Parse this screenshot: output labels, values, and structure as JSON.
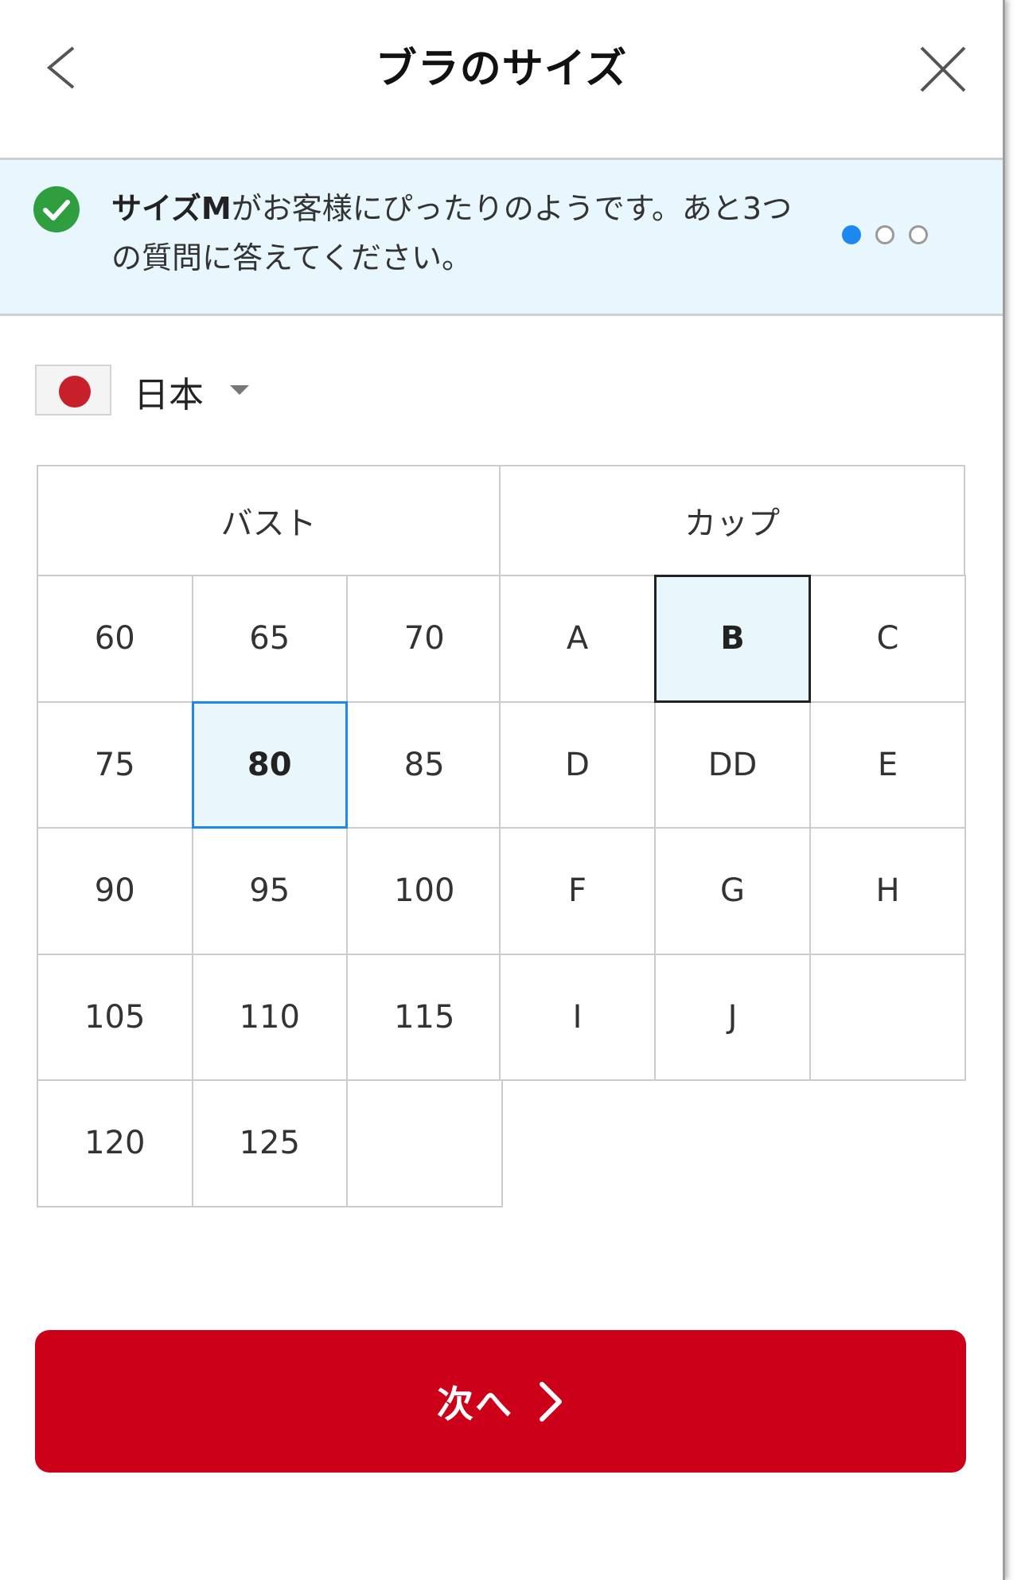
{
  "header": {
    "title": "ブラのサイズ"
  },
  "banner": {
    "bold_text": "サイズM",
    "message": "がお客様にぴったりのようです。あと3つの質問に答えてください。",
    "progress": {
      "current_step": 1,
      "total_steps": 3
    }
  },
  "country": {
    "name": "日本",
    "flag": "japan-flag"
  },
  "bust": {
    "header": "バスト",
    "options": [
      "60",
      "65",
      "70",
      "75",
      "80",
      "85",
      "90",
      "95",
      "100",
      "105",
      "110",
      "115",
      "120",
      "125"
    ],
    "selected": "80"
  },
  "cup": {
    "header": "カップ",
    "options": [
      "A",
      "B",
      "C",
      "D",
      "DD",
      "E",
      "F",
      "G",
      "H",
      "I",
      "J"
    ],
    "selected": "B"
  },
  "actions": {
    "next_label": "次へ"
  },
  "colors": {
    "accent_red": "#cc0019",
    "selection_blue": "#1e88f0",
    "banner_bg": "#e8f6fd",
    "check_green": "#2e9e3f"
  }
}
